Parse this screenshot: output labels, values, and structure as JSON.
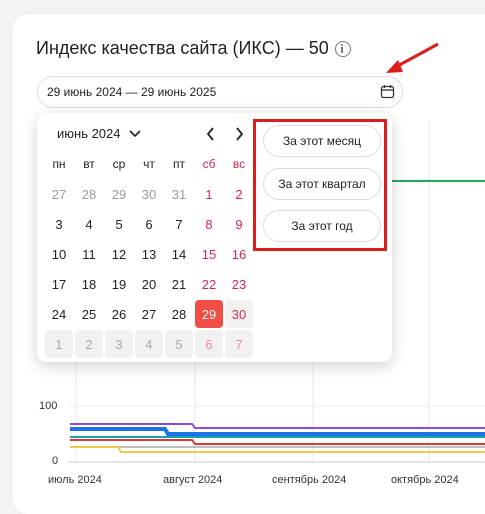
{
  "header": {
    "title": "Индекс качества сайта (ИКС) — 50"
  },
  "date_range": {
    "value": "29 июнь 2024 — 29 июнь 2025"
  },
  "calendar": {
    "month_label": "июнь 2024",
    "weekdays": [
      "пн",
      "вт",
      "ср",
      "чт",
      "пт",
      "сб",
      "вс"
    ],
    "rows": [
      [
        "27",
        "28",
        "29",
        "30",
        "31",
        "1",
        "2"
      ],
      [
        "3",
        "4",
        "5",
        "6",
        "7",
        "8",
        "9"
      ],
      [
        "10",
        "11",
        "12",
        "13",
        "14",
        "15",
        "16"
      ],
      [
        "17",
        "18",
        "19",
        "20",
        "21",
        "22",
        "23"
      ],
      [
        "24",
        "25",
        "26",
        "27",
        "28",
        "29",
        "30"
      ],
      [
        "1",
        "2",
        "3",
        "4",
        "5",
        "6",
        "7"
      ]
    ]
  },
  "presets": {
    "month": "За этот месяц",
    "quarter": "За этот квартал",
    "year": "За этот год"
  },
  "chart": {
    "y_ticks": [
      "100",
      "0"
    ],
    "x_ticks": [
      "июль 2024",
      "август 2024",
      "сентябрь 2024",
      "октябрь 2024"
    ],
    "colors": {
      "purple": "#8a4be0",
      "blue": "#1a73e8",
      "cyan": "#12a5a5",
      "red": "#d93838",
      "yellow": "#f2c94c",
      "green": "#1faa59"
    }
  }
}
